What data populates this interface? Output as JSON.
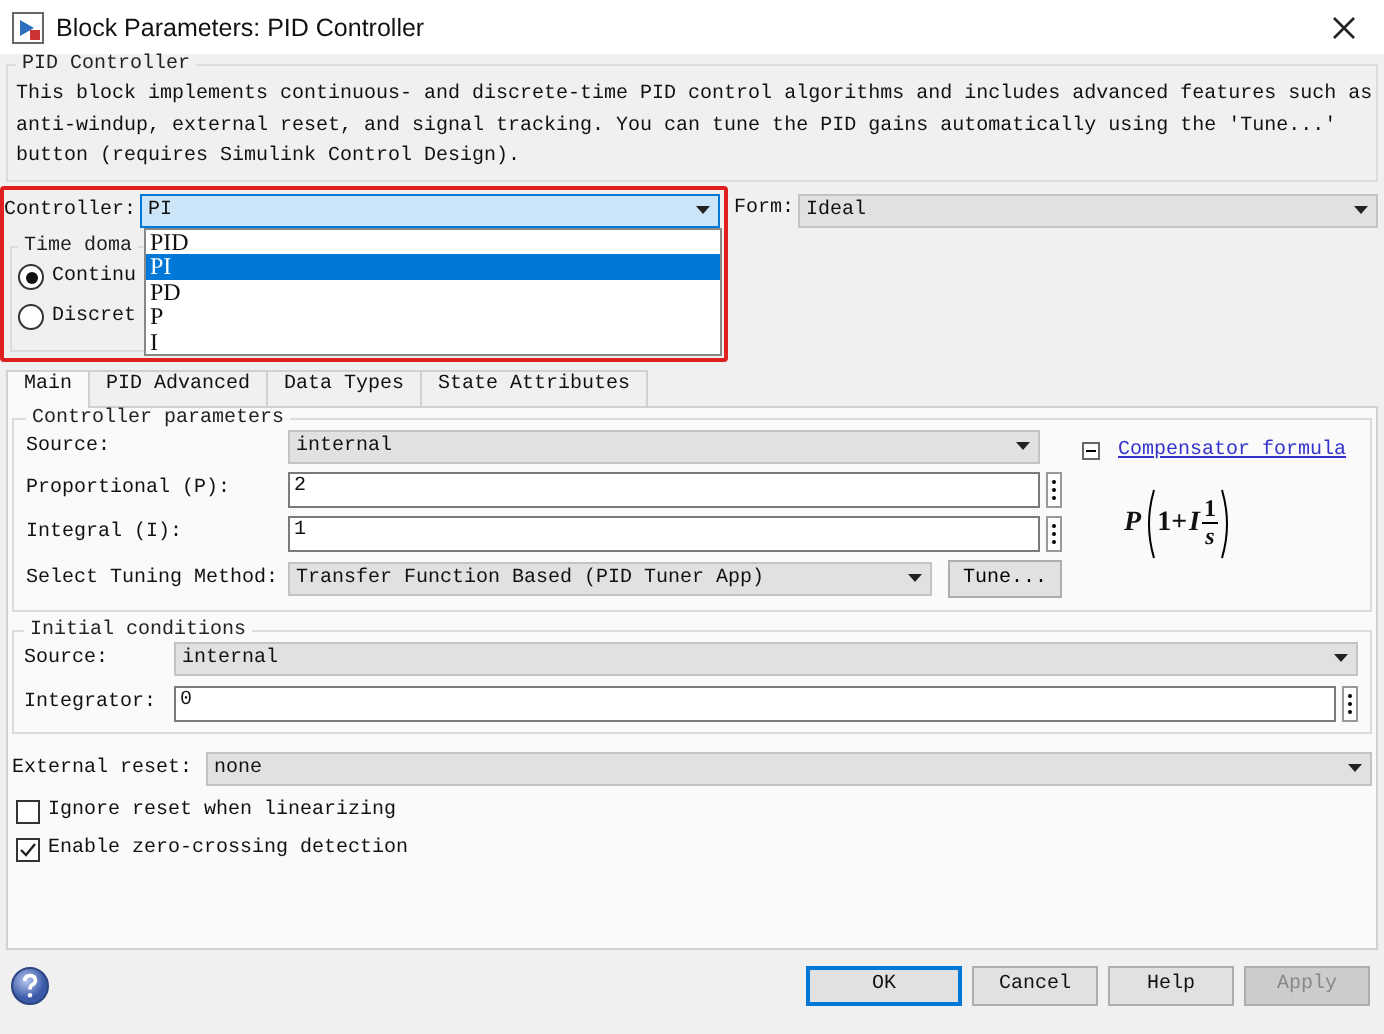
{
  "window": {
    "title": "Block Parameters: PID Controller"
  },
  "block": {
    "legend": "PID Controller",
    "description": "This block implements continuous- and discrete-time PID control algorithms and includes advanced features such as anti-windup, external reset, and signal tracking. You can tune the PID gains automatically using the 'Tune...' button (requires Simulink Control Design)."
  },
  "controller": {
    "label": "Controller:",
    "value": "PI",
    "options": [
      {
        "label": "PID",
        "selected": false
      },
      {
        "label": "PI",
        "selected": true
      },
      {
        "label": "PD",
        "selected": false
      },
      {
        "label": "P",
        "selected": false
      },
      {
        "label": "I",
        "selected": false
      }
    ]
  },
  "form": {
    "label": "Form:",
    "value": "Ideal"
  },
  "time_domain": {
    "legend": "Time doma",
    "options": [
      {
        "label": "Continu",
        "selected": true
      },
      {
        "label": "Discret",
        "selected": false
      }
    ]
  },
  "tabs": [
    {
      "label": "Main",
      "selected": true
    },
    {
      "label": "PID Advanced",
      "selected": false
    },
    {
      "label": "Data Types",
      "selected": false
    },
    {
      "label": "State Attributes",
      "selected": false
    }
  ],
  "controller_parameters": {
    "legend": "Controller parameters",
    "rows": [
      {
        "kind": "select",
        "label": "Source:",
        "value": "internal"
      },
      {
        "kind": "input",
        "label": "Proportional (P):",
        "value": "2"
      },
      {
        "kind": "input",
        "label": "Integral (I):",
        "value": "1"
      },
      {
        "kind": "tuning",
        "label": "Select Tuning Method:",
        "value": "Transfer Function Based (PID Tuner App)",
        "button": "Tune..."
      }
    ],
    "compensator_link": "Compensator formula",
    "formula": {
      "p": "P",
      "one_plus": "1+",
      "i": "I",
      "num": "1",
      "den": "s"
    }
  },
  "initial_conditions": {
    "legend": "Initial conditions",
    "rows": [
      {
        "kind": "select",
        "label": "Source:",
        "value": "internal"
      },
      {
        "kind": "input",
        "label": "Integrator:",
        "value": "0"
      }
    ]
  },
  "external_reset": {
    "label": "External reset:",
    "value": "none"
  },
  "checkboxes": [
    {
      "label": "Ignore reset when linearizing",
      "checked": false
    },
    {
      "label": "Enable zero-crossing detection",
      "checked": true
    }
  ],
  "buttons": [
    {
      "label": "OK",
      "disabled": false,
      "default": true
    },
    {
      "label": "Cancel",
      "disabled": false,
      "default": false
    },
    {
      "label": "Help",
      "disabled": false,
      "default": false
    },
    {
      "label": "Apply",
      "disabled": true,
      "default": false
    }
  ]
}
